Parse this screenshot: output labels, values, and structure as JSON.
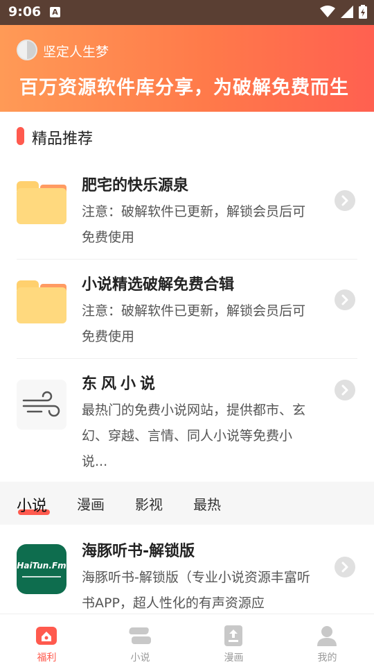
{
  "status_bar": {
    "time": "9:06",
    "notification_letter": "A"
  },
  "banner": {
    "owner_name": "坚定人生梦",
    "slogan": "百万资源软件库分享，为破解免费而生"
  },
  "section": {
    "title": "精品推荐"
  },
  "recommendations": [
    {
      "title": "肥宅的快乐源泉",
      "description": "注意：破解软件已更新，解锁会员后可免费使用",
      "icon": "folder-icon"
    },
    {
      "title": "小说精选破解免费合辑",
      "description": "注意：破解软件已更新，解锁会员后可免费使用",
      "icon": "folder-icon"
    },
    {
      "title": "东风小说",
      "description": "最热门的免费小说网站，提供都市、玄幻、穿越、言情、同人小说等免费小说...",
      "icon": "wind-icon"
    }
  ],
  "category_tabs": [
    {
      "label": "小说",
      "active": true
    },
    {
      "label": "漫画",
      "active": false
    },
    {
      "label": "影视",
      "active": false
    },
    {
      "label": "最热",
      "active": false
    }
  ],
  "apps": [
    {
      "title": "海豚听书-解锁版",
      "description": "海豚听书-解锁版（专业小说资源丰富听书APP，超人性化的有声资源应",
      "icon_text": "HaiTun.Fm"
    }
  ],
  "bottom_nav": [
    {
      "label": "福利",
      "active": true,
      "icon": "home-icon"
    },
    {
      "label": "小说",
      "active": false,
      "icon": "books-icon"
    },
    {
      "label": "漫画",
      "active": false,
      "icon": "comic-icon"
    },
    {
      "label": "我的",
      "active": false,
      "icon": "user-icon"
    }
  ],
  "colors": {
    "accent": "#ff5a4e",
    "banner_start": "#ff9a56",
    "banner_end": "#ff6050",
    "statusbar": "#5a3f33",
    "folder": "#ffd97e"
  }
}
